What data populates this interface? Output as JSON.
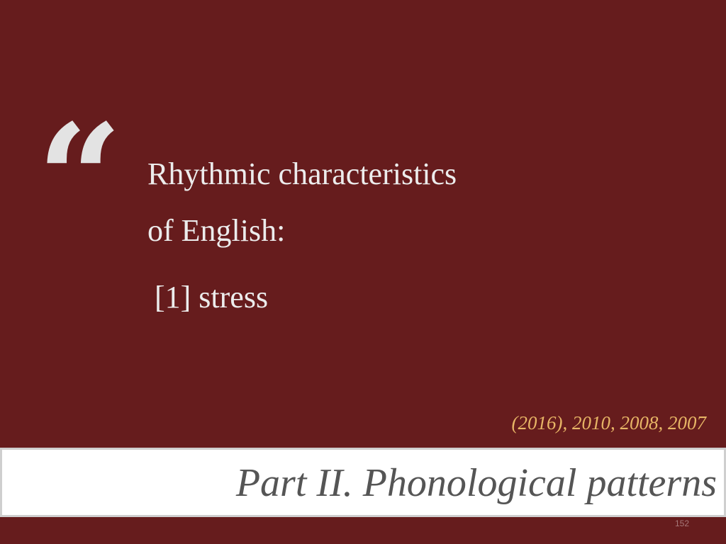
{
  "slide": {
    "quote_mark": "“",
    "quote_lines": [
      "Rhythmic characteristics",
      "of English:",
      "[1] stress"
    ],
    "years": "(2016), 2010, 2008, 2007",
    "title": "Part II. Phonological patterns",
    "page_number": "152"
  },
  "colors": {
    "background": "#661c1d",
    "quote_mark": "#e3e3e3",
    "quote_text": "#ececec",
    "years": "#e7b566",
    "title_text": "#555555",
    "title_band": "#ffffff",
    "title_border": "#cfcfcf",
    "page_number": "#a67879"
  }
}
